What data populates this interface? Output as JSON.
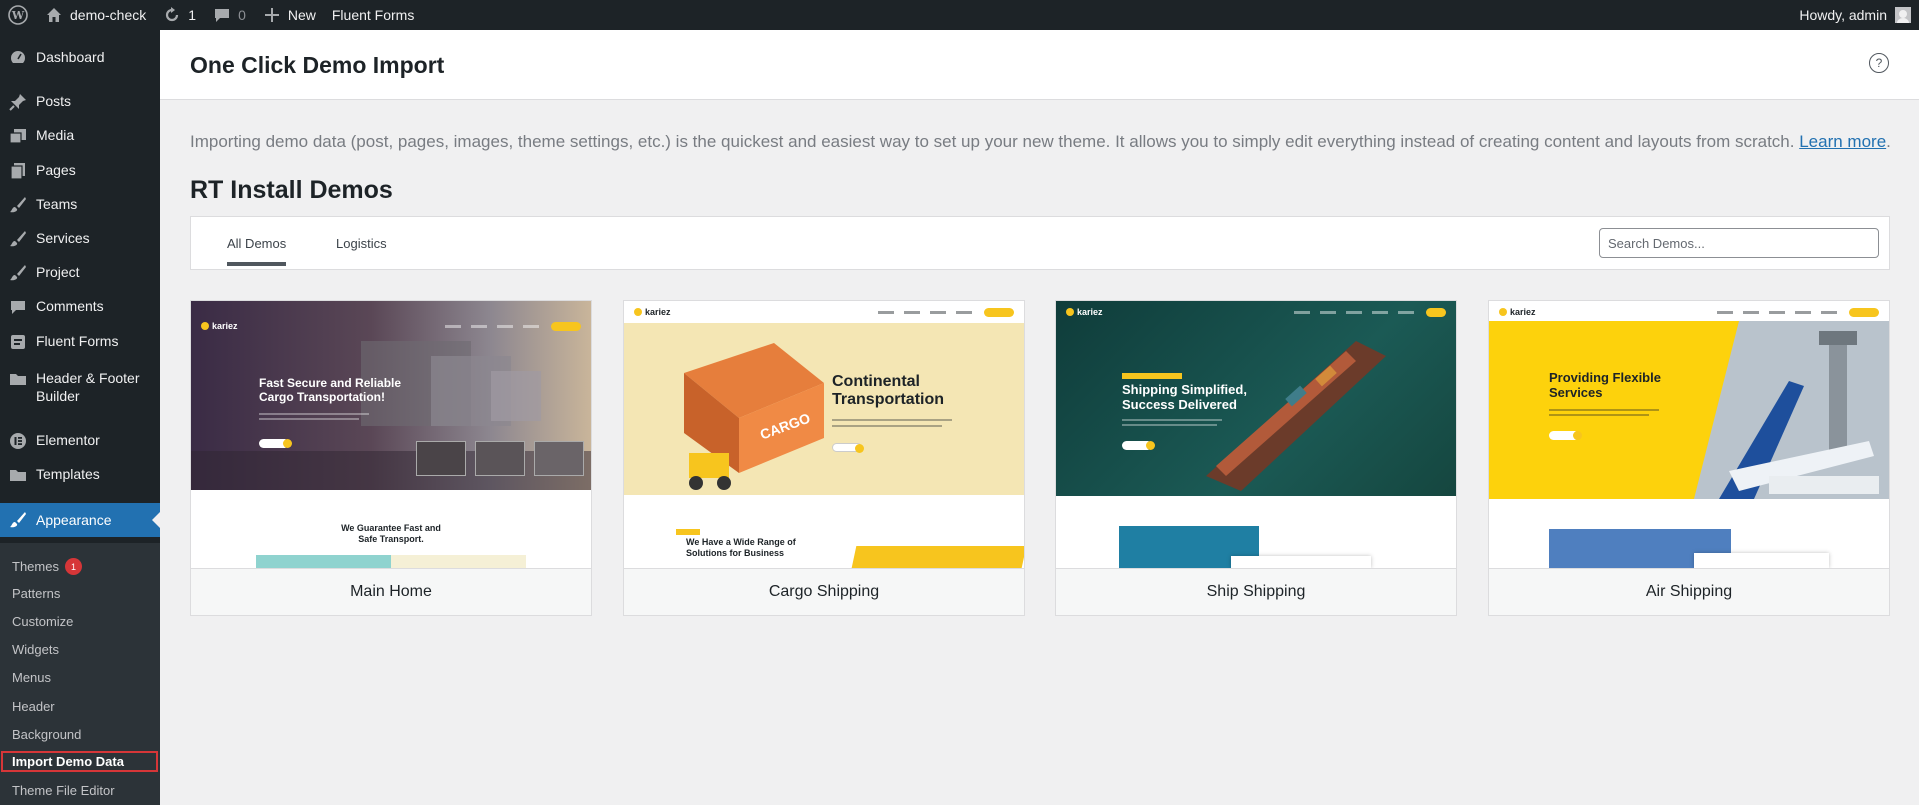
{
  "adminbar": {
    "site_name": "demo-check",
    "updates_count": "1",
    "comments_count": "0",
    "new_label": "New",
    "fluent_forms_label": "Fluent Forms",
    "howdy": "Howdy, admin"
  },
  "sidebar": {
    "items": [
      {
        "label": "Dashboard",
        "icon": "dashboard-icon"
      },
      {
        "label": "Posts",
        "icon": "pin-icon"
      },
      {
        "label": "Media",
        "icon": "media-icon"
      },
      {
        "label": "Pages",
        "icon": "pages-icon"
      },
      {
        "label": "Teams",
        "icon": "brush-icon"
      },
      {
        "label": "Services",
        "icon": "brush-icon"
      },
      {
        "label": "Project",
        "icon": "brush-icon"
      },
      {
        "label": "Comments",
        "icon": "comment-icon"
      },
      {
        "label": "Fluent Forms",
        "icon": "forms-icon"
      },
      {
        "label": "Header & Footer Builder",
        "icon": "folder-icon"
      },
      {
        "label": "Elementor",
        "icon": "elementor-icon"
      },
      {
        "label": "Templates",
        "icon": "folder-icon"
      },
      {
        "label": "Appearance",
        "icon": "appearance-icon"
      }
    ],
    "submenu": [
      {
        "label": "Themes",
        "badge": "1"
      },
      {
        "label": "Patterns"
      },
      {
        "label": "Customize"
      },
      {
        "label": "Widgets"
      },
      {
        "label": "Menus"
      },
      {
        "label": "Header"
      },
      {
        "label": "Background"
      },
      {
        "label": "Import Demo Data"
      },
      {
        "label": "Theme File Editor"
      }
    ]
  },
  "page": {
    "title": "One Click Demo Import",
    "intro": "Importing demo data (post, pages, images, theme settings, etc.) is the quickest and easiest way to set up your new theme. It allows you to simply edit everything instead of creating content and layouts from scratch.",
    "learn_more": "Learn more",
    "period": ".",
    "demos_title": "RT Install Demos"
  },
  "tabs": [
    "All Demos",
    "Logistics"
  ],
  "search": {
    "placeholder": "Search Demos..."
  },
  "demos": [
    {
      "title": "Main Home",
      "logo": "kariez",
      "hero": "Fast Secure and Reliable Cargo Transportation!",
      "section": "We Guarantee Fast and Safe Transport."
    },
    {
      "title": "Cargo Shipping",
      "logo": "kariez",
      "hero": "Continental Transportation",
      "section": "We Have a Wide Range of Solutions for Business",
      "crate": "CARGO"
    },
    {
      "title": "Ship Shipping",
      "logo": "kariez",
      "hero": "Shipping Simplified, Success Delivered"
    },
    {
      "title": "Air Shipping",
      "logo": "kariez",
      "hero": "Providing Flexible Services"
    }
  ],
  "colors": {
    "admin_dark": "#1d2327",
    "accent": "#2271b1",
    "brand_yellow": "#f7c51e"
  }
}
